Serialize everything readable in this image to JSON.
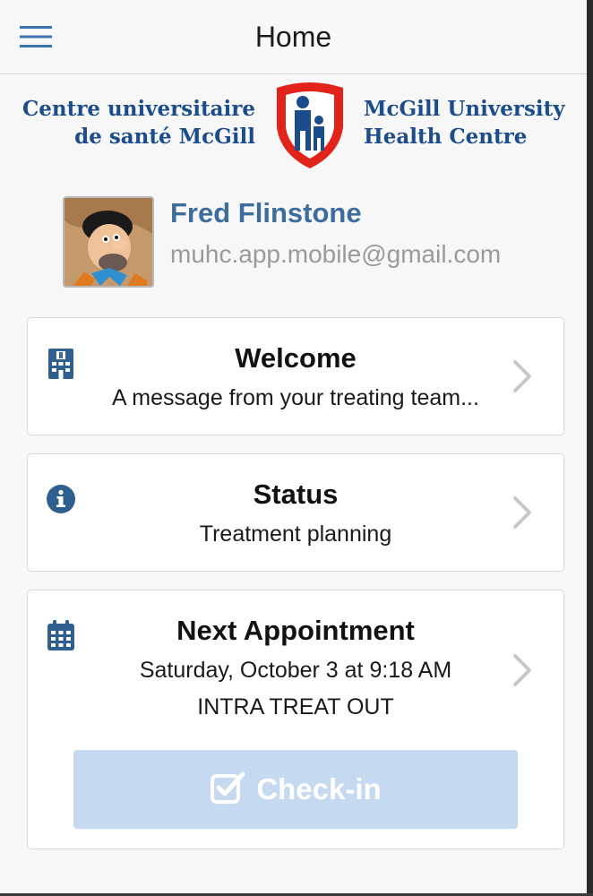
{
  "header": {
    "title": "Home"
  },
  "logo": {
    "french_line1": "Centre universitaire",
    "french_line2": "de santé McGill",
    "english_line1": "McGill University",
    "english_line2": "Health Centre"
  },
  "profile": {
    "name": "Fred Flinstone",
    "email": "muhc.app.mobile@gmail.com"
  },
  "cards": {
    "welcome": {
      "title": "Welcome",
      "subtitle": "A message from your treating team...",
      "icon": "hospital-icon"
    },
    "status": {
      "title": "Status",
      "subtitle": "Treatment planning",
      "icon": "info-circle-icon"
    },
    "appointment": {
      "title": "Next Appointment",
      "datetime": "Saturday, October 3 at 9:18 AM",
      "location": "INTRA TREAT OUT",
      "icon": "calendar-icon",
      "checkin_label": "Check-in",
      "checkin_icon": "checkbox-icon"
    }
  },
  "colors": {
    "accent": "#3d6d9f",
    "icon": "#2e5f8e",
    "checkin_disabled": "#c5d9f1",
    "logo_blue": "#1b4c8c",
    "logo_red": "#e2231a"
  }
}
